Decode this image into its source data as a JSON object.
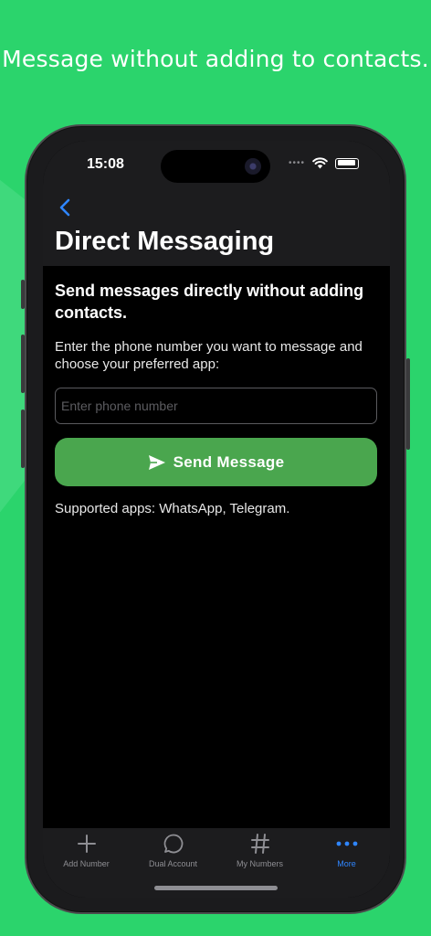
{
  "headline": "Message without adding to contacts.",
  "status_bar": {
    "time": "15:08"
  },
  "nav": {
    "back_icon": "chevron-left-icon",
    "title": "Direct Messaging"
  },
  "content": {
    "subtitle": "Send messages directly without adding contacts.",
    "description": "Enter the phone number you want to message and choose your preferred app:",
    "phone_input": {
      "value": "",
      "placeholder": "Enter phone number"
    },
    "send_button": {
      "label": "Send Message",
      "icon": "paper-plane-icon"
    },
    "supported_apps": "Supported apps: WhatsApp, Telegram."
  },
  "tab_bar": {
    "items": [
      {
        "label": "Add Number",
        "icon": "plus-icon",
        "active": false
      },
      {
        "label": "Dual Account",
        "icon": "chat-bubble-icon",
        "active": false
      },
      {
        "label": "My Numbers",
        "icon": "hash-icon",
        "active": false
      },
      {
        "label": "More",
        "icon": "more-dots-icon",
        "active": true
      }
    ]
  },
  "colors": {
    "background": "#2bd46c",
    "accent_blue": "#2f86ff",
    "button_green": "#4aa64e"
  }
}
